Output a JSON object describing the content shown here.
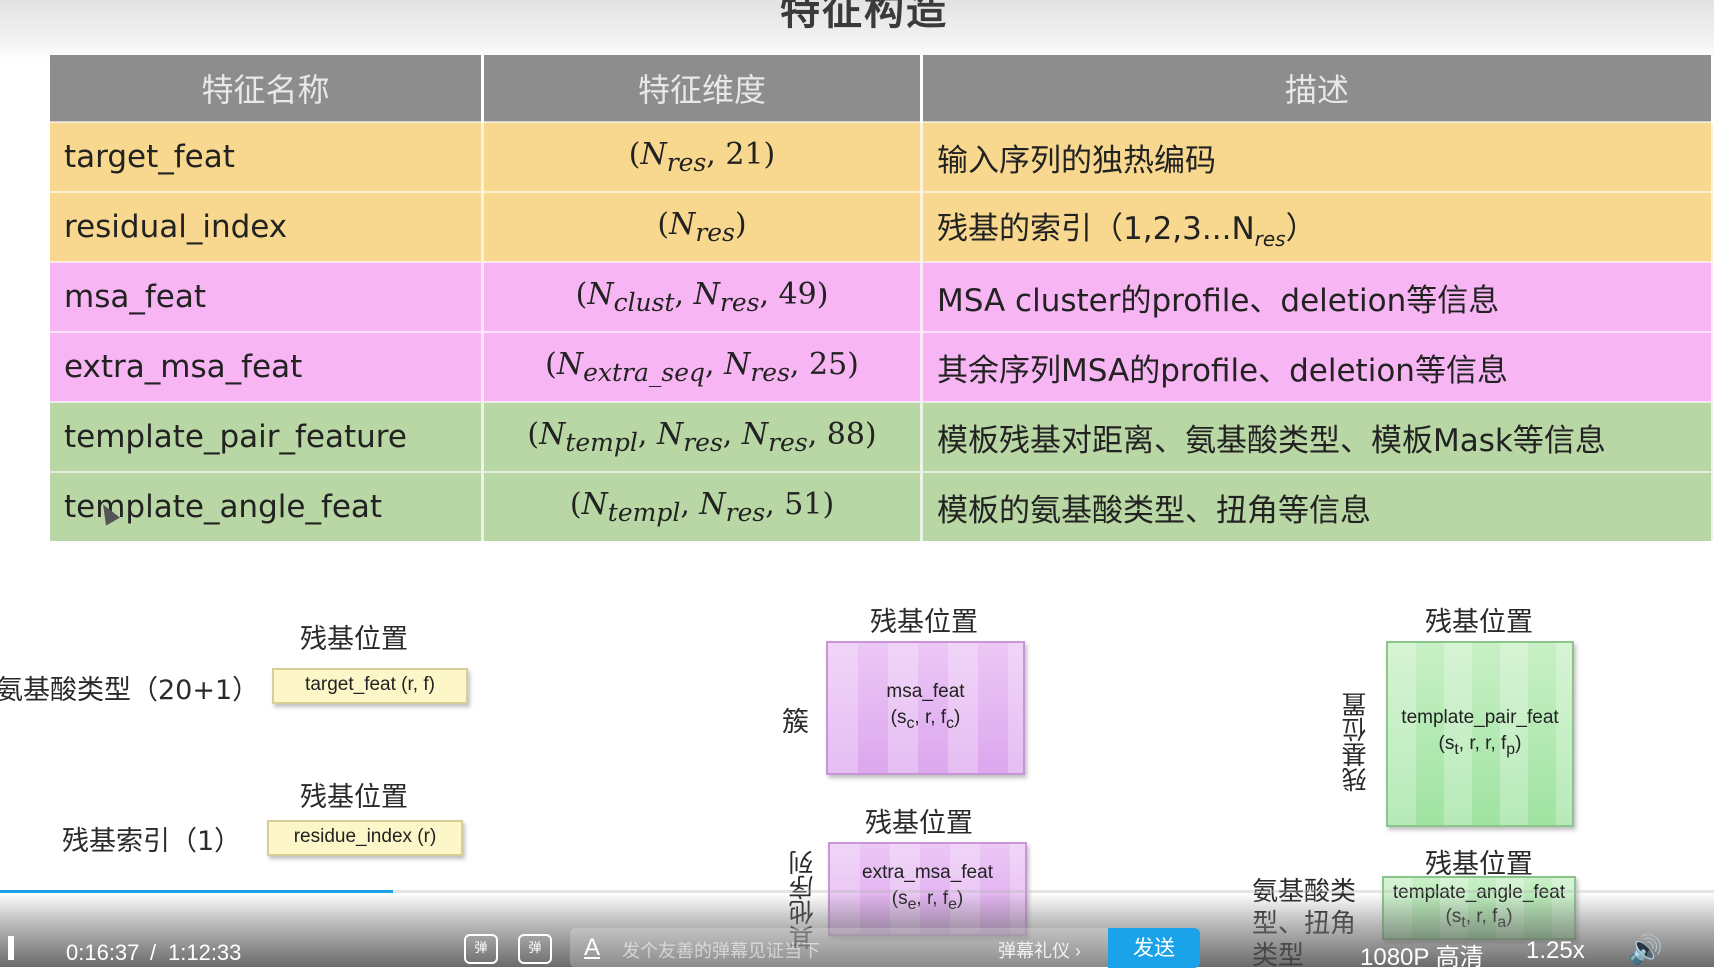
{
  "slide": {
    "title": "特征构造"
  },
  "table": {
    "headers": [
      "特征名称",
      "特征维度",
      "描述"
    ],
    "rows": [
      {
        "name": "target_feat",
        "dim_parts": [
          "(",
          "N",
          "res",
          ", 21)"
        ],
        "desc": "输入序列的独热编码"
      },
      {
        "name": "residual_index",
        "desc": "残基的索引（1,2,3...N",
        "desc_sub": "res",
        "desc_end": "）"
      },
      {
        "name": "msa_feat",
        "desc": "MSA cluster的profile、deletion等信息"
      },
      {
        "name": "extra_msa_feat",
        "desc": "其余序列MSA的profile、deletion等信息"
      },
      {
        "name": "template_pair_feature",
        "desc": "模板残基对距离、氨基酸类型、模板Mask等信息"
      },
      {
        "name": "template_angle_feat",
        "desc": "模板的氨基酸类型、扭角等信息"
      }
    ],
    "dims": {
      "r0": {
        "N": "N",
        "sub": "res",
        "rest": ", 21)"
      },
      "r1": {
        "N": "N",
        "sub": "res"
      },
      "r2": {
        "a": "N",
        "a_sub": "clust",
        "b": "N",
        "b_sub": "res",
        "rest": ", 49)"
      },
      "r3": {
        "a": "N",
        "a_sub": "extra_seq",
        "b": "N",
        "b_sub": "res",
        "rest": ", 25)"
      },
      "r4": {
        "a": "N",
        "a_sub": "templ",
        "b": "N",
        "b_sub": "res",
        "c": "N",
        "c_sub": "res",
        "rest": ", 88)"
      },
      "r5": {
        "a": "N",
        "a_sub": "templ",
        "b": "N",
        "b_sub": "res",
        "rest": ", 51)"
      }
    }
  },
  "diagrams": {
    "residue_position": "残基位置",
    "aa_type_label": "氨基酸类型（20+1）",
    "target_feat_box": "target_feat (r, f)",
    "residue_index_label": "残基索引（1）",
    "residue_index_box": "residue_index (r)",
    "cluster_label": "簇",
    "msa_feat_box_line1": "msa_feat",
    "msa_feat_box_line2": "(s",
    "other_seq_label": "其他序列",
    "extra_msa_box_line1": "extra_msa_feat",
    "template_pair_box_line1": "template_pair_feat",
    "template_angle_box_line1": "template_angle_feat",
    "aa_torsion_label": "氨基酸类型、扭角类型"
  },
  "player": {
    "current_time": "0:16:37",
    "separator": "/",
    "total_time": "1:12:33",
    "progress_fraction": 0.229,
    "danmaku_placeholder": "发个友善的弹幕见证当下",
    "danmaku_etiquette": "弹幕礼仪 ›",
    "send": "发送",
    "quality": "1080P 高清",
    "speed": "1.25x",
    "accent_color": "#1aa3e8"
  }
}
